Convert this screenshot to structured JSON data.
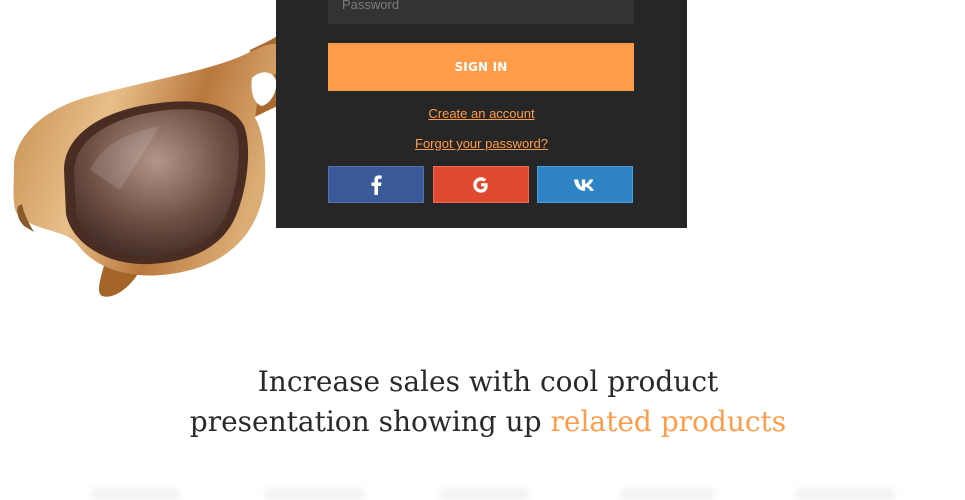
{
  "login": {
    "password_placeholder": "Password",
    "signin_label": "SIGN IN",
    "create_account_label": "Create an account",
    "forgot_password_label": "Forgot your password?"
  },
  "social": [
    {
      "name": "facebook",
      "icon": "facebook-icon",
      "color": "#3b5998"
    },
    {
      "name": "google",
      "icon": "google-icon",
      "color": "#e04a30"
    },
    {
      "name": "vk",
      "icon": "vk-icon",
      "color": "#2f84c6"
    }
  ],
  "headline": {
    "line1": "Increase sales with cool product",
    "line2_start": "presentation showing up ",
    "line2_accent": "related products"
  },
  "colors": {
    "accent": "#ff9c4a",
    "panel": "#262626"
  }
}
